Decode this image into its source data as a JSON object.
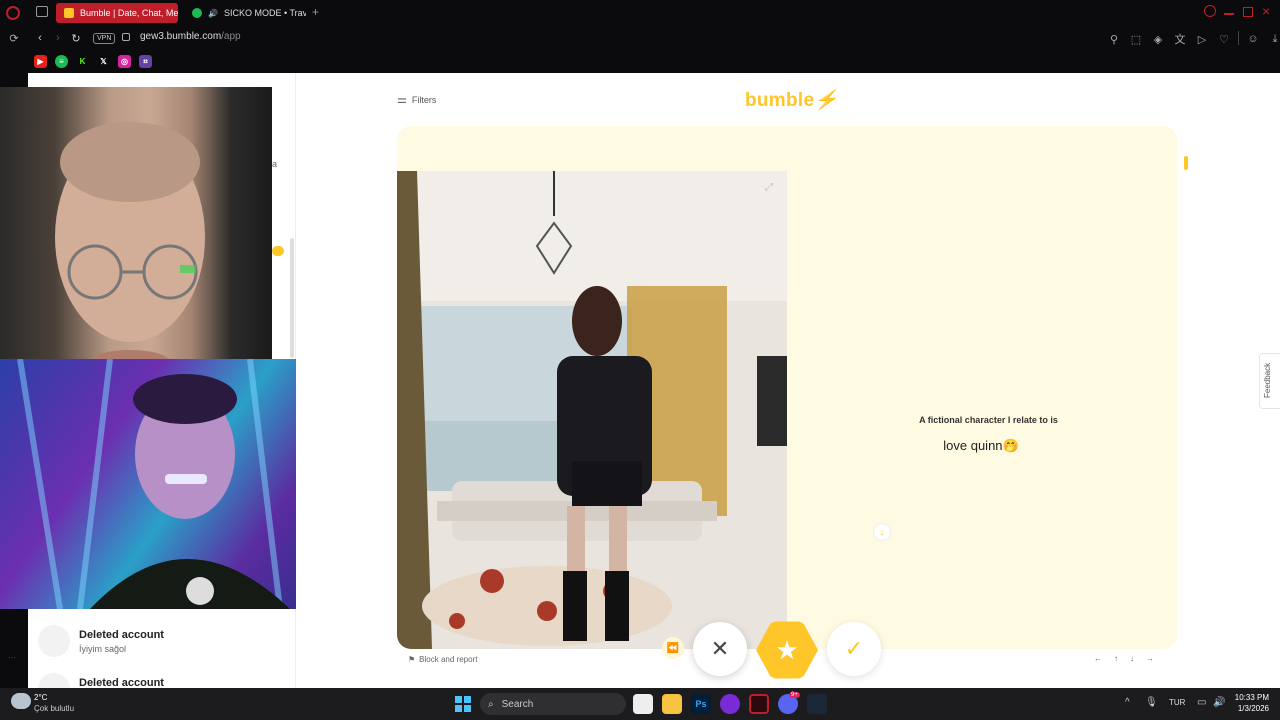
{
  "browser": {
    "tabs": [
      {
        "label": "Bumble | Date, Chat, Mee",
        "active": true
      },
      {
        "label": "SICKO MODE • Travis",
        "active": false
      }
    ],
    "url_host": "gew3.bumble.com",
    "url_path": "/app",
    "vpn_label": "VPN"
  },
  "main": {
    "filters_label": "Filters",
    "logo_text": "bumble",
    "prompt_question": "A fictional character I relate to is",
    "prompt_answer": "love quinn🤭",
    "block_report_label": "Block and report",
    "feedback_label": "Feedback"
  },
  "sidebar": {
    "chats": [
      {
        "name": "Deleted account",
        "snippet": "İyiyim sağol"
      },
      {
        "name": "Deleted account",
        "snippet": ""
      }
    ],
    "partial_text": "a"
  },
  "taskbar": {
    "weather_temp": "2°C",
    "weather_desc": "Çok bulutlu",
    "search_label": "Search",
    "lang": "TUR",
    "time": "10:33 PM",
    "date": "1/3/2026",
    "ps_label": "Ps",
    "discord_badge": "9+"
  },
  "colors": {
    "accent": "#ffc629",
    "card_bg": "#fffbe3",
    "browser_bg": "#0b0b0e",
    "tab_active": "#be1d2a"
  }
}
